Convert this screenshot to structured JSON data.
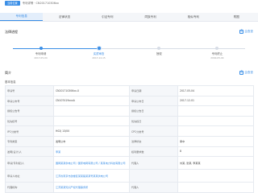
{
  "breadcrumb": {
    "tag": "当前位置",
    "path": "专利详情 · CN201710306xx"
  },
  "tabs": [
    {
      "label": "专利信息",
      "active": true
    },
    {
      "label": "法律状态",
      "active": false
    },
    {
      "label": "引证专利",
      "active": false
    },
    {
      "label": "同族专利",
      "active": false
    },
    {
      "label": "相似专利",
      "active": false
    },
    {
      "label": "附图",
      "active": false
    }
  ],
  "progress_section": {
    "title": "法律进程",
    "share_label": "企查查"
  },
  "steps": [
    {
      "label": "专利申请",
      "date": "2017-05-04",
      "state": "done"
    },
    {
      "label": "实质审查",
      "date": "2017-12-15",
      "state": "current"
    },
    {
      "label": "授权",
      "date": "",
      "state": "todo"
    },
    {
      "label": "专利终止",
      "date": "2040-05-04",
      "state": "todo"
    }
  ],
  "detail_section": {
    "title": "简介",
    "share_label": "企查查",
    "subhead": "基本信息"
  },
  "rows": [
    {
      "k1": "申请号",
      "v1": "CN201710306xx.X",
      "k2": "申请日期",
      "v2": "2017-05-04"
    },
    {
      "k1": "申请公布号",
      "v1": "CN107419xxxA",
      "k2": "申请公布日",
      "v2": "2017-12-01"
    },
    {
      "k1": "授权公告号",
      "v1": "",
      "k2": "授权公告日",
      "v2": ""
    },
    {
      "k1": "优先权号",
      "v1": "",
      "k2": "优先权日",
      "v2": ""
    },
    {
      "k1": "IPC分类号",
      "v1": "H02J 13/00",
      "k2": "CPC分类号",
      "v2": ""
    },
    {
      "k1": "专利类型",
      "v1": "发明公布",
      "k2": "法律状态",
      "v2": "审中"
    },
    {
      "k1": "发明(设计)人",
      "v1": "李某",
      "k2": "权利要求数",
      "v2": "8"
    },
    {
      "k1": "申请(专利权)人",
      "v1": "国网某某供电公司 / 国家电网有限公司 / 某某电力科技有限公司",
      "k2": "代理人",
      "v2": "刘某, 张某, 李某某"
    },
    {
      "k1": "申请人地址",
      "v1": "江苏省南京市鼓楼区某某路某某号某某供电公司",
      "k2": "",
      "v2": ""
    },
    {
      "k1": "代理机构",
      "v1": "江苏某某知识产权代理事务所",
      "k2": "代理人",
      "v2": ""
    }
  ]
}
